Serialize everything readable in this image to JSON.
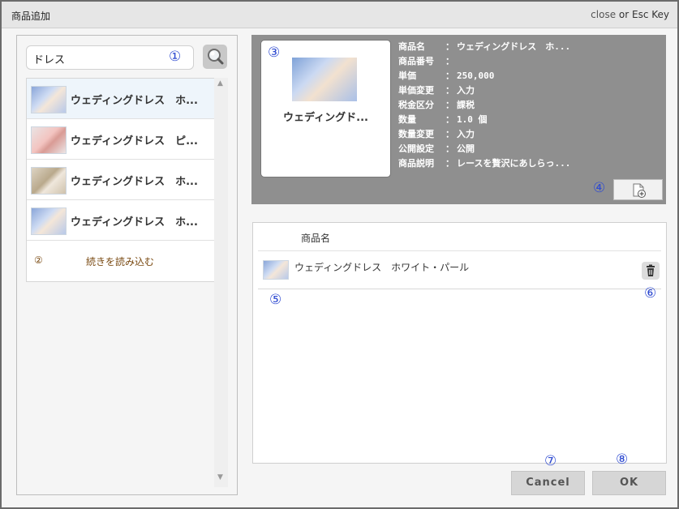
{
  "window": {
    "title": "商品追加",
    "close_hint_close": "close",
    "close_hint_rest": " or Esc Key"
  },
  "search": {
    "value": "ドレス"
  },
  "results": [
    {
      "label": "ウェディングドレス　ホ..."
    },
    {
      "label": "ウェディングドレス　ピ..."
    },
    {
      "label": "ウェディングドレス　ホ..."
    },
    {
      "label": "ウェディングドレス　ホ..."
    }
  ],
  "load_more_label": "続きを読み込む",
  "markers": {
    "m1": "①",
    "m2": "②",
    "m3": "③",
    "m4": "④",
    "m5": "⑤",
    "m6": "⑥",
    "m7": "⑦",
    "m8": "⑧"
  },
  "detail": {
    "card_label": "ウェディングド...",
    "properties": [
      {
        "key": "商品名",
        "sep": "：",
        "value": "ウェディングドレス　ホ..."
      },
      {
        "key": "商品番号",
        "sep": "：",
        "value": ""
      },
      {
        "key": "単価",
        "sep": "：",
        "value": "250,000"
      },
      {
        "key": "単価変更",
        "sep": "：",
        "value": "入力"
      },
      {
        "key": "税金区分",
        "sep": "：",
        "value": "課税"
      },
      {
        "key": "数量",
        "sep": "：",
        "value": "1.0 個"
      },
      {
        "key": "数量変更",
        "sep": "：",
        "value": "入力"
      },
      {
        "key": "公開設定",
        "sep": "：",
        "value": "公開"
      },
      {
        "key": "商品説明",
        "sep": "：",
        "value": "レースを贅沢にあしらっ..."
      }
    ]
  },
  "selected": {
    "column_header": "商品名",
    "rows": [
      {
        "label": "ウェディングドレス　ホワイト・パール"
      }
    ]
  },
  "buttons": {
    "cancel": "Cancel",
    "ok": "OK"
  },
  "colors": {
    "marker": "#2f4bd1",
    "detail_bg": "#8f8f8f",
    "load_more_text": "#7a4a12"
  }
}
